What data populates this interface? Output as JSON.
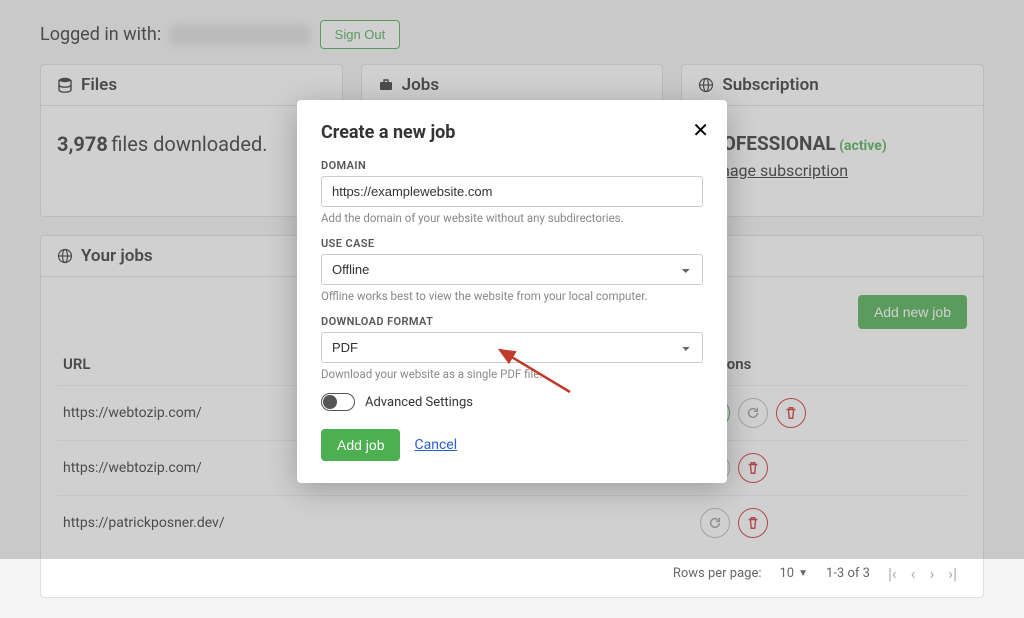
{
  "header": {
    "logged_in_prefix": "Logged in with:",
    "sign_out": "Sign Out"
  },
  "cards": {
    "files": {
      "title": "Files",
      "count": "3,978",
      "rest": "files downloaded."
    },
    "jobs": {
      "title": "Jobs"
    },
    "subscription": {
      "title": "Subscription",
      "plan_prefix": "PROFESSIONAL",
      "status": "(active)",
      "manage": "Manage subscription"
    }
  },
  "jobs_panel": {
    "title": "Your jobs",
    "add_new": "Add new job",
    "col_url": "URL",
    "col_actions": "Actions",
    "rows": [
      {
        "url": "https://webtozip.com/"
      },
      {
        "url": "https://webtozip.com/"
      },
      {
        "url": "https://patrickposner.dev/"
      }
    ],
    "pagination": {
      "rows_per_page_label": "Rows per page:",
      "rows_per_page_value": "10",
      "range": "1-3 of 3"
    }
  },
  "modal": {
    "title": "Create a new job",
    "domain_label": "DOMAIN",
    "domain_value": "https://examplewebsite.com",
    "domain_hint": "Add the domain of your website without any subdirectories.",
    "use_case_label": "USE CASE",
    "use_case_value": "Offline",
    "use_case_hint": "Offline works best to view the website from your local computer.",
    "format_label": "DOWNLOAD FORMAT",
    "format_value": "PDF",
    "format_hint": "Download your website as a single PDF file.",
    "advanced": "Advanced Settings",
    "add_job": "Add job",
    "cancel": "Cancel"
  }
}
